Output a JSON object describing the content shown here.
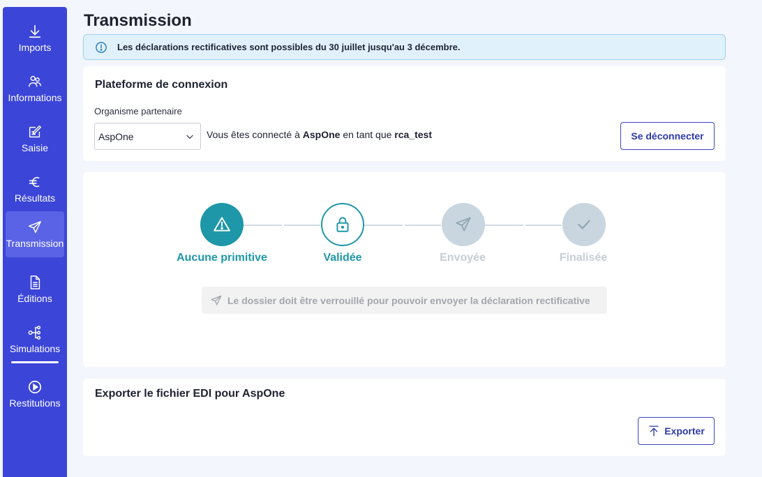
{
  "sidebar": {
    "items": [
      {
        "label": "Imports",
        "icon": "download-icon"
      },
      {
        "label": "Informations",
        "icon": "people-icon"
      },
      {
        "label": "Saisie",
        "icon": "edit-icon"
      },
      {
        "label": "Résultats",
        "icon": "euro-icon"
      },
      {
        "label": "Transmission",
        "icon": "send-icon",
        "active": true
      },
      {
        "label": "Éditions",
        "icon": "document-icon"
      },
      {
        "label": "Simulations",
        "icon": "network-icon"
      },
      {
        "label": "Restitutions",
        "icon": "play-icon"
      }
    ]
  },
  "page": {
    "title": "Transmission"
  },
  "banner": {
    "text": "Les déclarations rectificatives sont possibles du 30 juillet jusqu'au 3 décembre."
  },
  "connection": {
    "title": "Plateforme de connexion",
    "field_label": "Organisme partenaire",
    "selected": "AspOne",
    "text_prefix": "Vous êtes connecté à",
    "platform": "AspOne",
    "text_middle": "en tant que",
    "user": "rca_test",
    "disconnect_label": "Se déconnecter"
  },
  "stepper": {
    "steps": [
      {
        "label": "Aucune primitive",
        "state": "current",
        "icon": "warning-icon"
      },
      {
        "label": "Validée",
        "state": "outlined",
        "icon": "lock-icon"
      },
      {
        "label": "Envoyée",
        "state": "disabled",
        "icon": "send-icon"
      },
      {
        "label": "Finalisée",
        "state": "disabled",
        "icon": "check-icon"
      }
    ],
    "notice": "Le dossier doit être verrouillé pour pouvoir envoyer la déclaration rectificative"
  },
  "export": {
    "title": "Exporter le fichier EDI pour AspOne",
    "button_label": "Exporter"
  },
  "colors": {
    "sidebar": "#3b45d8",
    "accent_teal": "#1e97a8",
    "disabled": "#c9d6df",
    "primary_text": "#2d3aa8"
  }
}
